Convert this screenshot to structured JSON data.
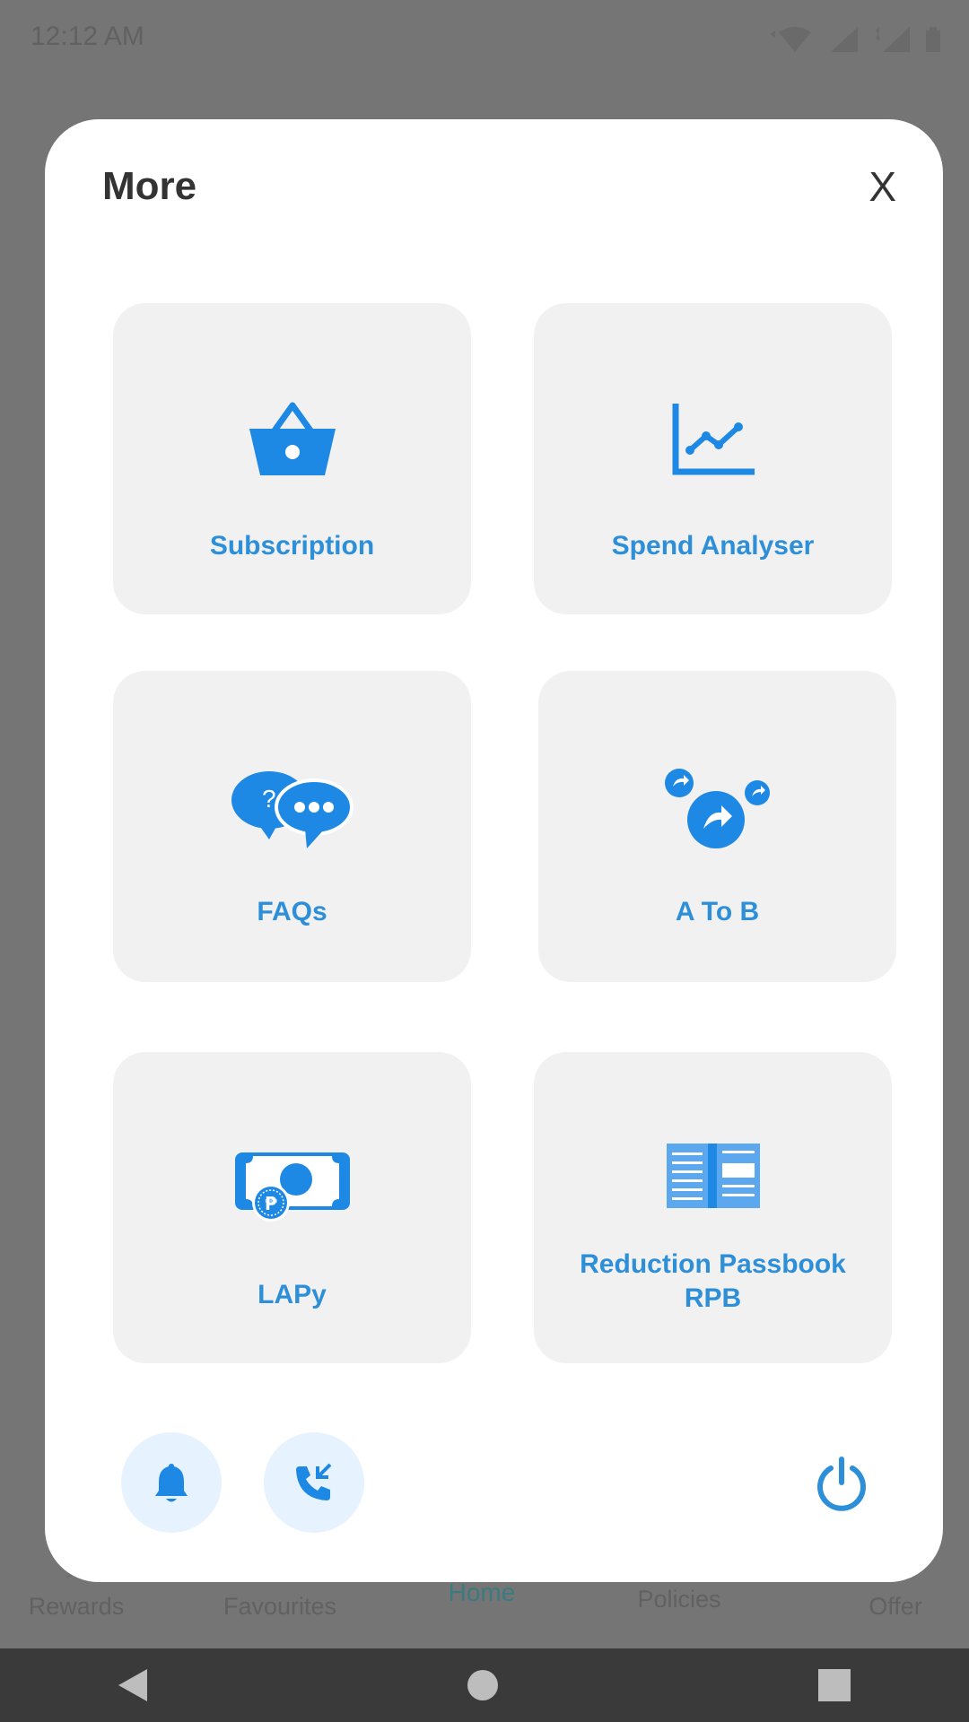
{
  "status_bar": {
    "time": "12:12 AM"
  },
  "modal": {
    "title": "More",
    "close_label": "X",
    "tiles": [
      {
        "label": "Subscription",
        "icon": "basket-icon"
      },
      {
        "label": "Spend Analyser",
        "icon": "line-chart-icon"
      },
      {
        "label": "FAQs",
        "icon": "chat-bubbles-icon"
      },
      {
        "label": "A To B",
        "icon": "share-bubbles-icon"
      },
      {
        "label": "LAPy",
        "icon": "cash-icon"
      },
      {
        "label": "Reduction Passbook RPB",
        "icon": "passbook-icon"
      }
    ],
    "footer": {
      "notification_icon": "bell-icon",
      "call_icon": "phone-callback-icon",
      "power_icon": "power-icon"
    }
  },
  "bottom_nav": {
    "items": [
      {
        "label": "Rewards"
      },
      {
        "label": "Favourites"
      },
      {
        "label": "Home"
      },
      {
        "label": "Policies"
      },
      {
        "label": "Offer"
      }
    ],
    "active": "Home"
  },
  "colors": {
    "accent": "#2e8fd9",
    "icon_blue": "#1e88e5",
    "tile_bg": "#f1f1f2",
    "round_btn_bg": "#e6f2fd",
    "overlay": "#757575"
  }
}
